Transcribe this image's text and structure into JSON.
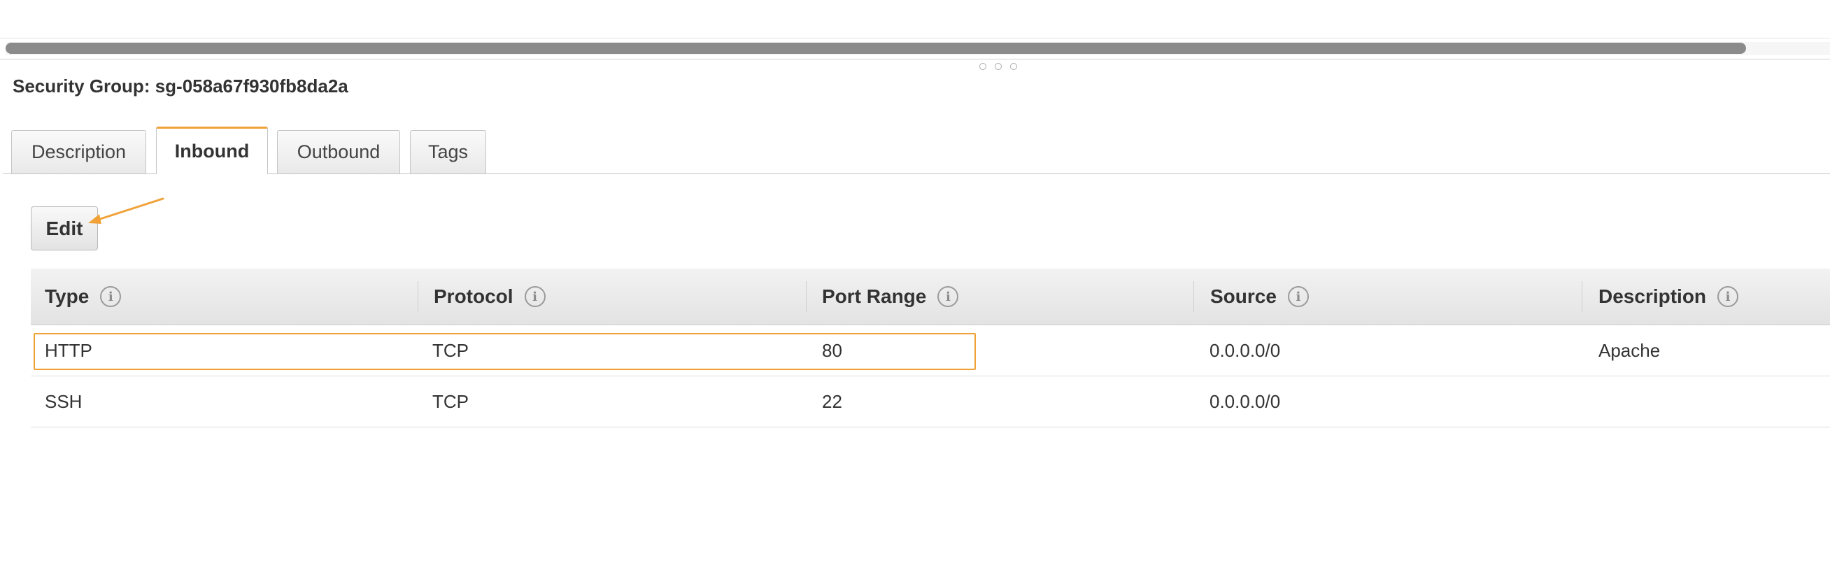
{
  "security_group": {
    "title": "Security Group: sg-058a67f930fb8da2a"
  },
  "tabs": [
    {
      "label": "Description",
      "active": false
    },
    {
      "label": "Inbound",
      "active": true
    },
    {
      "label": "Outbound",
      "active": false
    },
    {
      "label": "Tags",
      "active": false
    }
  ],
  "toolbar": {
    "edit_label": "Edit"
  },
  "table": {
    "columns": [
      "Type",
      "Protocol",
      "Port Range",
      "Source",
      "Description"
    ],
    "info_icon": "i",
    "rows": [
      {
        "type": "HTTP",
        "protocol": "TCP",
        "port_range": "80",
        "source": "0.0.0.0/0",
        "description": "Apache"
      },
      {
        "type": "SSH",
        "protocol": "TCP",
        "port_range": "22",
        "source": "0.0.0.0/0",
        "description": ""
      }
    ]
  },
  "colors": {
    "accent": "#f0a238",
    "scrollbar": "#8b8b8b"
  }
}
